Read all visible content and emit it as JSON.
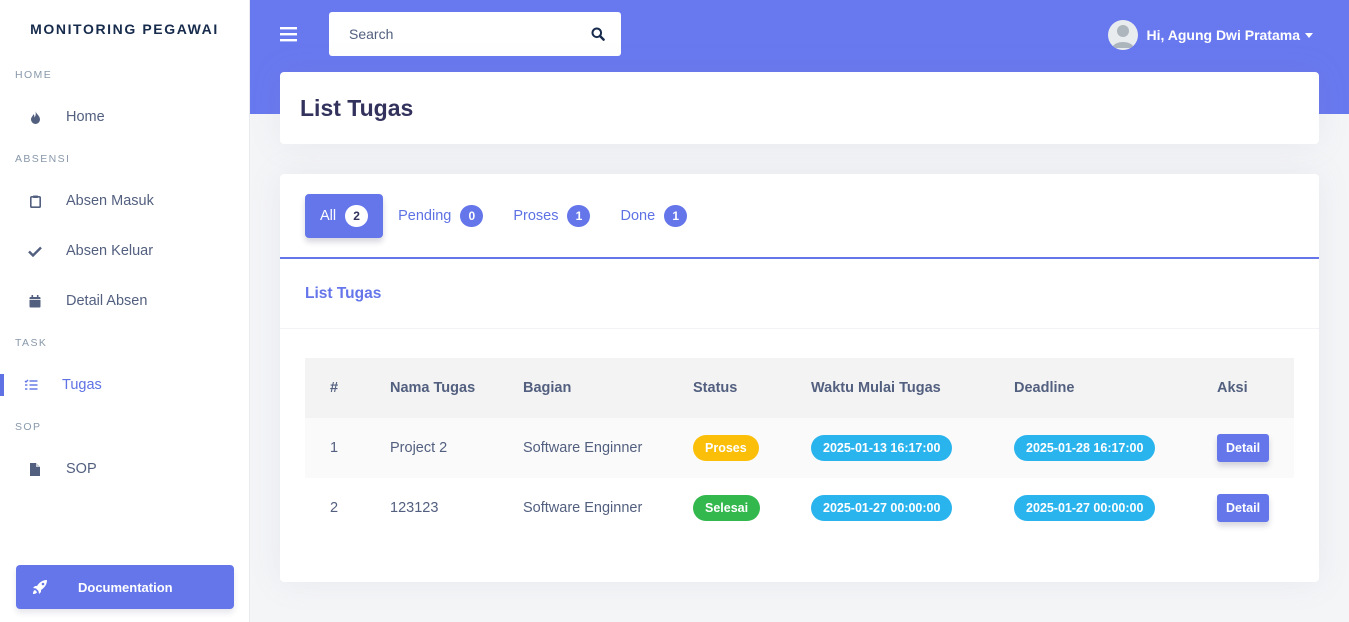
{
  "sidebar": {
    "brand": "MONITORING PEGAWAI",
    "sections": [
      {
        "heading": "HOME",
        "items": [
          {
            "label": "Home",
            "icon": "fire-icon"
          }
        ]
      },
      {
        "heading": "ABSENSI",
        "items": [
          {
            "label": "Absen Masuk",
            "icon": "clipboard-icon"
          },
          {
            "label": "Absen Keluar",
            "icon": "check-icon"
          },
          {
            "label": "Detail Absen",
            "icon": "calendar-icon"
          }
        ]
      },
      {
        "heading": "TASK",
        "items": [
          {
            "label": "Tugas",
            "icon": "list-icon",
            "active": true
          }
        ]
      },
      {
        "heading": "SOP",
        "items": [
          {
            "label": "SOP",
            "icon": "file-icon"
          }
        ]
      }
    ],
    "documentation_label": "Documentation"
  },
  "topbar": {
    "search_placeholder": "Search",
    "user_greeting": "Hi, Agung Dwi Pratama"
  },
  "page": {
    "title": "List Tugas",
    "tabs": [
      {
        "label": "All",
        "count": "2",
        "active": true
      },
      {
        "label": "Pending",
        "count": "0"
      },
      {
        "label": "Proses",
        "count": "1"
      },
      {
        "label": "Done",
        "count": "1"
      }
    ],
    "list_title": "List Tugas",
    "table": {
      "headers": [
        "#",
        "Nama Tugas",
        "Bagian",
        "Status",
        "Waktu Mulai Tugas",
        "Deadline",
        "Aksi"
      ],
      "rows": [
        {
          "no": "1",
          "nama": "Project 2",
          "bagian": "Software Enginner",
          "status": "Proses",
          "mulai": "2025-01-13 16:17:00",
          "deadline": "2025-01-28 16:17:00",
          "aksi": "Detail"
        },
        {
          "no": "2",
          "nama": "123123",
          "bagian": "Software Enginner",
          "status": "Selesai",
          "mulai": "2025-01-27 00:00:00",
          "deadline": "2025-01-27 00:00:00",
          "aksi": "Detail"
        }
      ]
    }
  },
  "colors": {
    "primary": "#6576ea",
    "topbar": "#6878ef",
    "proses": "#fbbf0a",
    "selesai": "#33b84d",
    "time": "#2ab4ee"
  }
}
